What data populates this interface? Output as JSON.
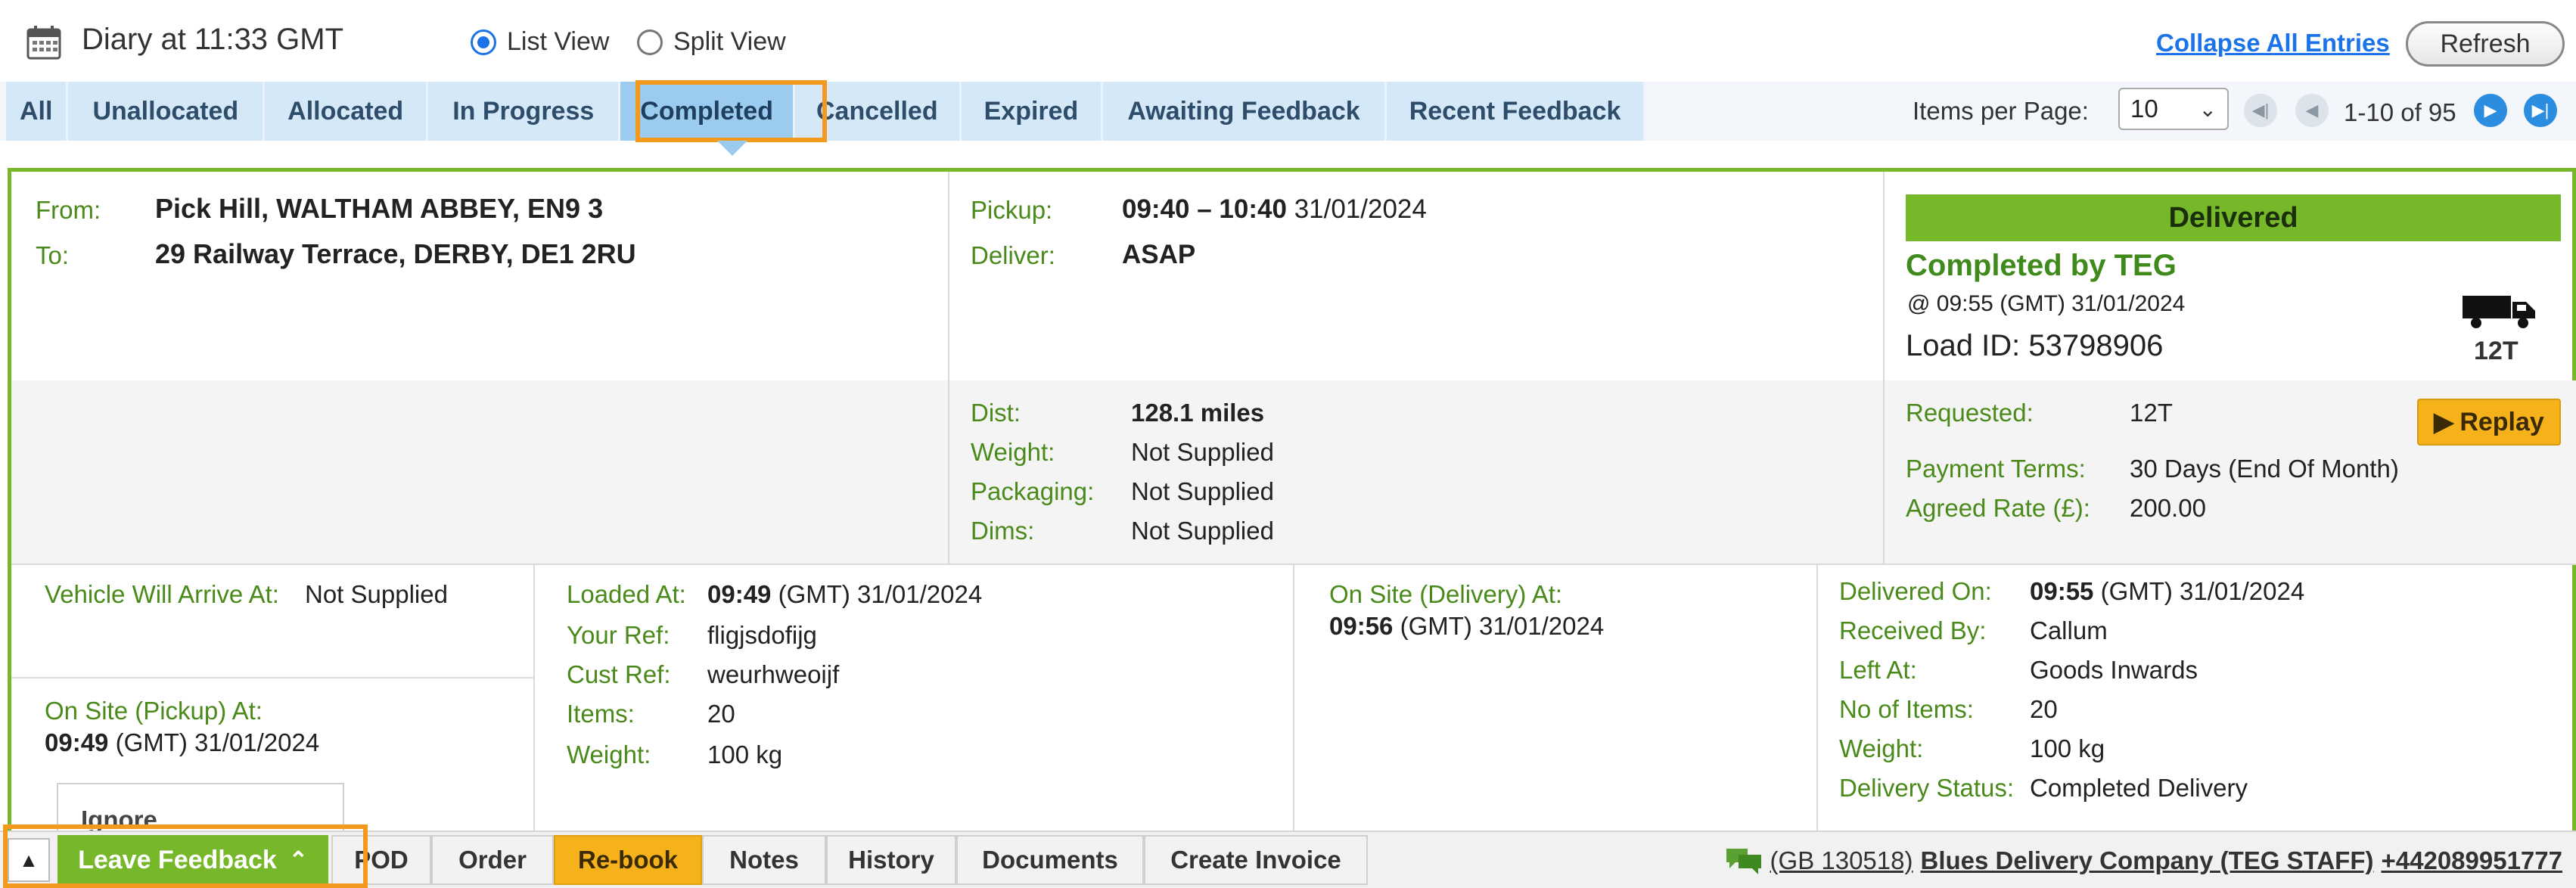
{
  "header": {
    "title": "Diary at 11:33 GMT",
    "views": [
      {
        "label": "List View",
        "checked": true
      },
      {
        "label": "Split View",
        "checked": false
      }
    ],
    "collapse_label": "Collapse All Entries",
    "refresh_label": "Refresh"
  },
  "tabs": [
    {
      "label": "All"
    },
    {
      "label": "Unallocated"
    },
    {
      "label": "Allocated"
    },
    {
      "label": "In Progress"
    },
    {
      "label": "Completed",
      "active": true
    },
    {
      "label": "Cancelled"
    },
    {
      "label": "Expired"
    },
    {
      "label": "Awaiting Feedback"
    },
    {
      "label": "Recent Feedback"
    }
  ],
  "pagination": {
    "items_per_page_label": "Items per Page:",
    "items_per_page": "10",
    "range": "1-10 of 95"
  },
  "entry": {
    "from_label": "From:",
    "from": "Pick Hill, WALTHAM ABBEY, EN9 3",
    "to_label": "To:",
    "to": "29 Railway Terrace, DERBY, DE1 2RU",
    "pickup_label": "Pickup:",
    "pickup_time": "09:40 – 10:40",
    "pickup_date": "31/01/2024",
    "deliver_label": "Deliver:",
    "deliver": "ASAP",
    "status": "Delivered",
    "completed_by": "Completed by TEG",
    "completed_at": "@ 09:55 (GMT) 31/01/2024",
    "load_id_label": "Load ID:",
    "load_id": "53798906",
    "vehicle": "12T",
    "details": {
      "dist_label": "Dist:",
      "dist": "128.1 miles",
      "weight_label": "Weight:",
      "weight": "Not Supplied",
      "packaging_label": "Packaging:",
      "packaging": "Not Supplied",
      "dims_label": "Dims:",
      "dims": "Not Supplied"
    },
    "terms": {
      "requested_label": "Requested:",
      "requested": "12T",
      "payment_label": "Payment Terms:",
      "payment": "30 Days (End Of Month)",
      "rate_label": "Agreed Rate (£):",
      "rate": "200.00"
    },
    "replay_label": "Replay",
    "vehicle_arrive_label": "Vehicle Will Arrive At:",
    "vehicle_arrive": "Not Supplied",
    "onsite_pickup_label": "On Site (Pickup) At:",
    "onsite_pickup_time": "09:49",
    "onsite_pickup_rest": "(GMT)  31/01/2024",
    "ignore_label": "Ignore",
    "loaded": {
      "loaded_label": "Loaded At:",
      "loaded_time": "09:49",
      "loaded_rest": "(GMT)  31/01/2024",
      "your_ref_label": "Your Ref:",
      "your_ref": "fligjsdofijg",
      "cust_ref_label": "Cust Ref:",
      "cust_ref": "weurhweoijf",
      "items_label": "Items:",
      "items": "20",
      "weight_label": "Weight:",
      "weight": "100 kg"
    },
    "onsite_delivery_label": "On Site (Delivery) At:",
    "onsite_delivery_time": "09:56",
    "onsite_delivery_rest": "(GMT)  31/01/2024",
    "delivered": {
      "on_label": "Delivered On:",
      "on_time": "09:55",
      "on_rest": "(GMT)  31/01/2024",
      "received_label": "Received By:",
      "received": "Callum",
      "left_label": "Left At:",
      "left": "Goods Inwards",
      "items_label": "No of Items:",
      "items": "20",
      "weight_label": "Weight:",
      "weight": "100 kg",
      "status_label": "Delivery Status:",
      "status": "Completed Delivery"
    }
  },
  "actions": {
    "feedback_label": "Leave Feedback",
    "buttons": [
      "POD",
      "Order",
      "Re-book",
      "Notes",
      "History",
      "Documents",
      "Create Invoice"
    ],
    "contact_code": "(GB 130518)",
    "contact_company": "Blues Delivery Company (TEG STAFF)",
    "contact_phone": "+442089951777"
  },
  "colors": {
    "accent_green": "#76b82a",
    "highlight_orange": "#f39a1e",
    "tab_blue": "#d4e8f7",
    "link_blue": "#1a73e8",
    "rebook_yellow": "#f6b21b"
  }
}
